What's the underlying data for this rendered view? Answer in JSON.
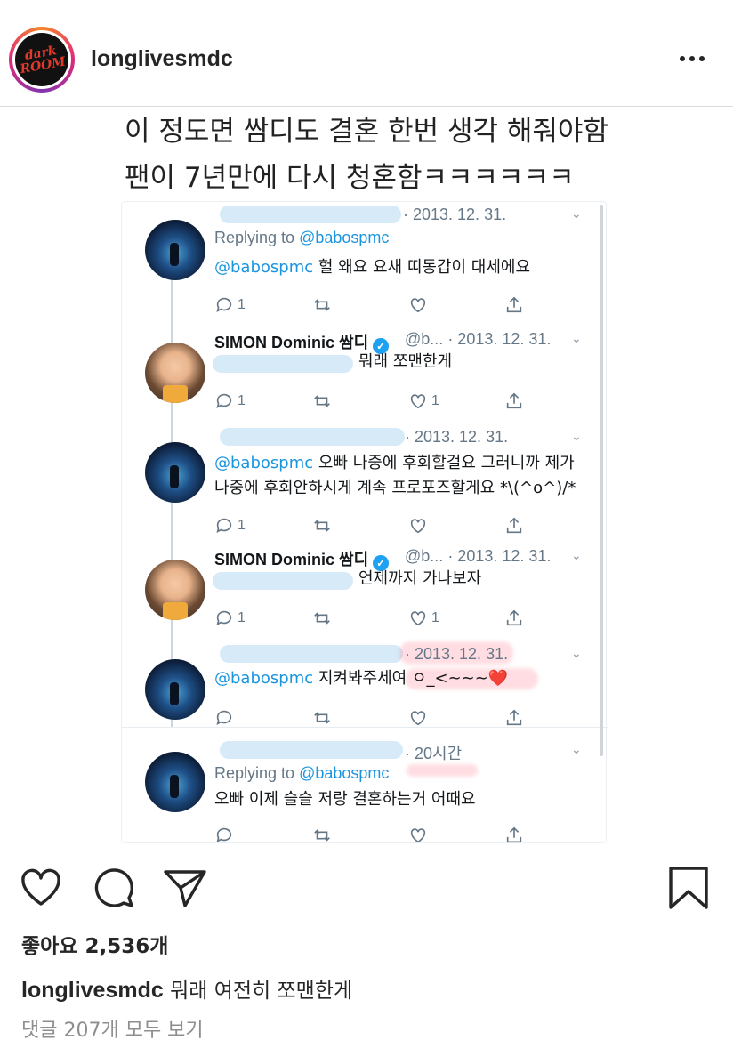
{
  "header": {
    "logo_text": "dark ROOM",
    "username": "longlivesmdc",
    "more_icon": "more-horizontal-icon"
  },
  "image": {
    "caption_line1": "이 정도면 쌈디도 결혼 한번 생각 해줘야함",
    "caption_line2": "팬이 7년만에 다시 청혼함ㅋㅋㅋㅋㅋㅋ",
    "tweets": [
      {
        "name": "",
        "handle": "",
        "time": "· 2013. 12. 31.",
        "reply_prefix": "Replying to ",
        "reply_mention": "@babospmc",
        "mention": "@babospmc",
        "text": " 헐 왜요 요새 띠동갑이 대세에요",
        "reply_count": "1",
        "like_count": ""
      },
      {
        "name": "SIMON Dominic 쌈디",
        "handle": "@b...",
        "time": "· 2013. 12. 31.",
        "text": "뭐래 쪼맨한게",
        "reply_count": "1",
        "like_count": "1"
      },
      {
        "name": "",
        "time": "· 2013. 12. 31.",
        "mention": "@babospmc",
        "text": " 오빠 나중에 후회할걸요 그러니까 제가",
        "text2": "나중에 후회안하시게 계속 프로포즈할게요 *\\(^o^)/*",
        "reply_count": "1",
        "like_count": ""
      },
      {
        "name": "SIMON Dominic 쌈디",
        "handle": "@b...",
        "time": "· 2013. 12. 31.",
        "text": "언제까지 가나보자",
        "reply_count": "1",
        "like_count": "1"
      },
      {
        "name": "",
        "time": "· 2013. 12. 31.",
        "mention": "@babospmc",
        "text": " 지켜봐주세여 ㅇ_<~~~",
        "heart": "❤️",
        "reply_count": "",
        "like_count": ""
      },
      {
        "name": "",
        "time": "· 20시간",
        "reply_prefix": "Replying to ",
        "reply_mention": "@babospmc",
        "text": "오빠 이제 슬슬 저랑 결혼하는거 어때요",
        "reply_count": "",
        "like_count": ""
      }
    ]
  },
  "actions": {
    "like_icon": "heart-icon",
    "comment_icon": "comment-icon",
    "share_icon": "send-icon",
    "save_icon": "bookmark-icon"
  },
  "likes_label": "좋아요 2,536개",
  "caption": {
    "username": "longlivesmdc",
    "text": " 뭐래 여전히 쪼맨한게"
  },
  "comments_link": "댓글 207개 모두 보기"
}
